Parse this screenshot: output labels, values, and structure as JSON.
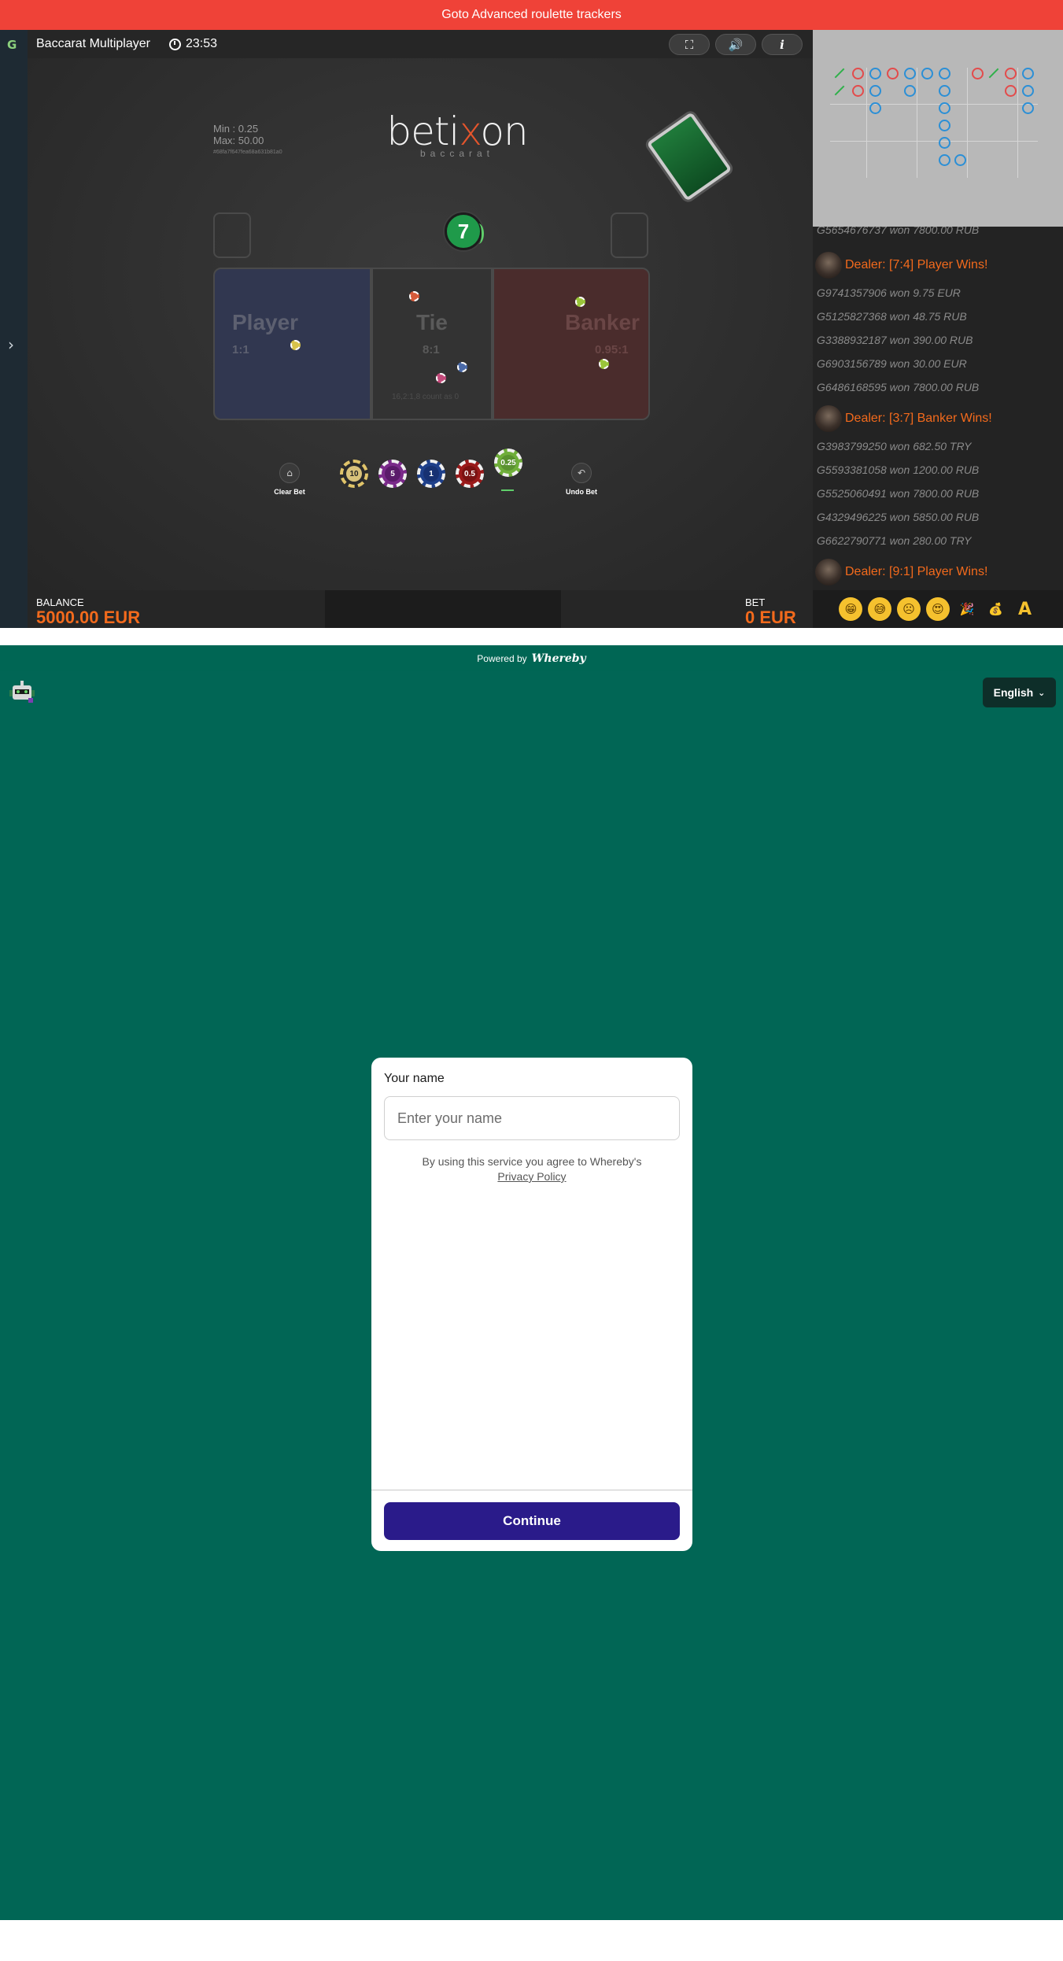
{
  "banner": {
    "text": "Goto Advanced roulette trackers"
  },
  "game": {
    "title": "Baccarat Multiplayer",
    "timer": "23:53",
    "buttons": {
      "fullscreen_icon": "fullscreen-icon",
      "sound_icon": "speaker-icon",
      "info_icon": "info-icon"
    },
    "limits": {
      "min": "Min : 0.25",
      "max": "Max: 50.00",
      "hash": "#68fa7f647fea68a631b81a0"
    },
    "brand": {
      "name_left": "beti",
      "name_x": "x",
      "name_right": "on",
      "sub": "baccarat"
    },
    "round_number": "7",
    "zones": {
      "player": {
        "label": "Player",
        "odds": "1:1"
      },
      "tie": {
        "label": "Tie",
        "odds": "8:1",
        "note": "16,2:1,8 count as 0"
      },
      "banker": {
        "label": "Banker",
        "odds": "0.95:1"
      }
    },
    "actions": {
      "clear": "Clear Bet",
      "undo": "Undo Bet"
    },
    "chips": [
      "10",
      "5",
      "1",
      "0.5",
      "0.25"
    ],
    "footer": {
      "balance_label": "BALANCE",
      "balance_value": "5000.00 EUR",
      "bet_label": "BET",
      "bet_value": "0 EUR"
    }
  },
  "feed": {
    "lines": [
      {
        "type": "win",
        "text": "G5654676737 won 7800.00 RUB"
      },
      {
        "type": "dealer",
        "text": "Dealer: [7:4] Player Wins!"
      },
      {
        "type": "win",
        "text": "G9741357906 won 9.75 EUR"
      },
      {
        "type": "win",
        "text": "G5125827368 won 48.75 RUB"
      },
      {
        "type": "win",
        "text": "G3388932187 won 390.00 RUB"
      },
      {
        "type": "win",
        "text": "G6903156789 won 30.00 EUR"
      },
      {
        "type": "win",
        "text": "G6486168595 won 7800.00 RUB"
      },
      {
        "type": "dealer",
        "text": "Dealer: [3:7] Banker Wins!"
      },
      {
        "type": "win",
        "text": "G3983799250 won 682.50 TRY"
      },
      {
        "type": "win",
        "text": "G5593381058 won 1200.00 RUB"
      },
      {
        "type": "win",
        "text": "G5525060491 won 7800.00 RUB"
      },
      {
        "type": "win",
        "text": "G4329496225 won 5850.00 RUB"
      },
      {
        "type": "win",
        "text": "G6622790771 won 280.00 TRY"
      },
      {
        "type": "dealer",
        "text": "Dealer: [9:1] Player Wins!"
      }
    ],
    "emojis": [
      "😁",
      "😅",
      "☹",
      "😍",
      "🎉",
      "💰",
      "A"
    ]
  },
  "whereby": {
    "powered_by": "Powered by",
    "brand": "Whereby",
    "language": "English",
    "dialog": {
      "label": "Your name",
      "placeholder": "Enter your name",
      "terms": "By using this service you agree to Whereby's",
      "privacy": "Privacy Policy",
      "continue": "Continue"
    }
  },
  "colors": {
    "banner": "#ef4238",
    "accent_orange": "#f36a1c",
    "whereby_green": "#016655",
    "continue": "#2a1b8a"
  }
}
